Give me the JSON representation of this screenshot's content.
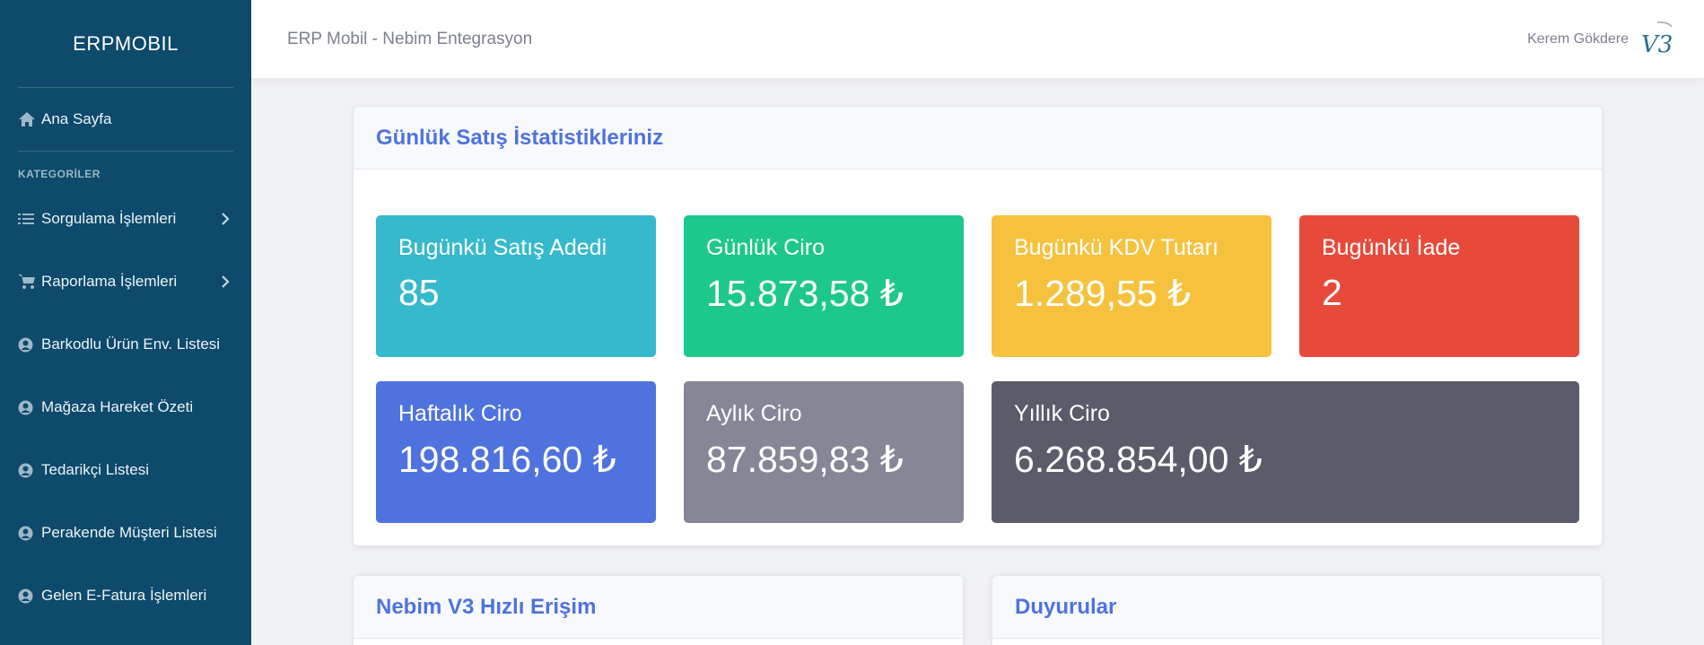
{
  "sidebar": {
    "brand": "ERPMOBIL",
    "home_label": "Ana Sayfa",
    "section_heading": "KATEGORİLER",
    "items": [
      {
        "label": "Sorgulama İşlemleri",
        "icon": "list-check-icon",
        "has_submenu": true
      },
      {
        "label": "Raporlama İşlemleri",
        "icon": "cart-icon",
        "has_submenu": true
      },
      {
        "label": "Barkodlu Ürün Env. Listesi",
        "icon": "user-circle-icon",
        "has_submenu": false
      },
      {
        "label": "Mağaza Hareket Özeti",
        "icon": "user-circle-icon",
        "has_submenu": false
      },
      {
        "label": "Tedarikçi Listesi",
        "icon": "user-circle-icon",
        "has_submenu": false
      },
      {
        "label": "Perakende Müşteri Listesi",
        "icon": "user-circle-icon",
        "has_submenu": false
      },
      {
        "label": "Gelen E-Fatura İşlemleri",
        "icon": "user-circle-icon",
        "has_submenu": false
      }
    ]
  },
  "topbar": {
    "title": "ERP Mobil - Nebim Entegrasyon",
    "user_name": "Kerem Gökdere",
    "logo_text": "V3"
  },
  "stats_card": {
    "title": "Günlük Satış İstatistikleriniz",
    "stats": [
      {
        "label": "Bugünkü Satış Adedi",
        "value": "85",
        "color": "#36b9cc"
      },
      {
        "label": "Günlük Ciro",
        "value": "15.873,58 ₺",
        "color": "#1cc88a"
      },
      {
        "label": "Bugünkü KDV Tutarı",
        "value": "1.289,55 ₺",
        "color": "#f6c23e"
      },
      {
        "label": "Bugünkü İade",
        "value": "2",
        "color": "#e74a3b"
      },
      {
        "label": "Haftalık Ciro",
        "value": "198.816,60 ₺",
        "color": "#4e73df"
      },
      {
        "label": "Aylık Ciro",
        "value": "87.859,83 ₺",
        "color": "#858796"
      },
      {
        "label": "Yıllık Ciro",
        "value": "6.268.854,00 ₺",
        "color": "#5a5c69"
      }
    ]
  },
  "quick_access_card": {
    "title": "Nebim V3 Hızlı Erişim"
  },
  "announcements_card": {
    "title": "Duyurular"
  }
}
